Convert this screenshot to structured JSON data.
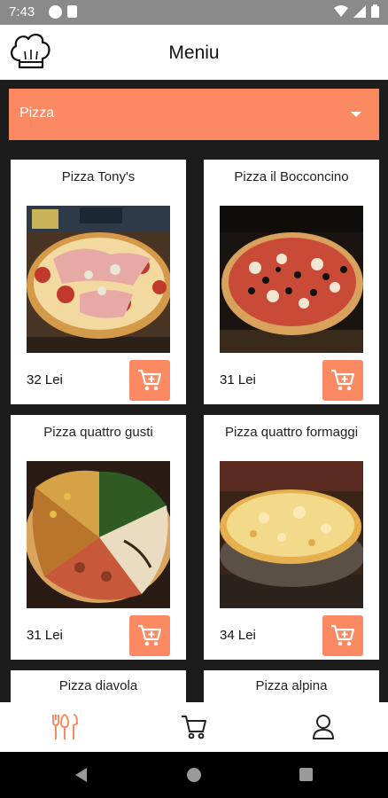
{
  "status_bar": {
    "time": "7:43",
    "icons": [
      "notification-icon",
      "sim-card-icon",
      "wifi-icon",
      "signal-icon",
      "battery-icon"
    ]
  },
  "app_bar": {
    "title": "Meniu",
    "logo_icon": "chef-hat-icon"
  },
  "category_dropdown": {
    "selected": "Pizza",
    "icon": "chevron-down-icon"
  },
  "colors": {
    "accent": "#fb8a62",
    "content_background": "#1c1c1c",
    "status_bar": "#8a8a8a"
  },
  "products": [
    {
      "name": "Pizza Tony's",
      "price": "32 Lei"
    },
    {
      "name": "Pizza il Bocconcino",
      "price": "31 Lei"
    },
    {
      "name": "Pizza quattro gusti",
      "price": "31 Lei"
    },
    {
      "name": "Pizza quattro formaggi",
      "price": "34 Lei"
    },
    {
      "name": "Pizza diavola",
      "price": ""
    },
    {
      "name": "Pizza alpina",
      "price": ""
    }
  ],
  "bottom_nav": {
    "items": [
      {
        "icon": "cutlery-icon",
        "active": true
      },
      {
        "icon": "cart-icon",
        "active": false
      },
      {
        "icon": "user-icon",
        "active": false
      }
    ]
  }
}
